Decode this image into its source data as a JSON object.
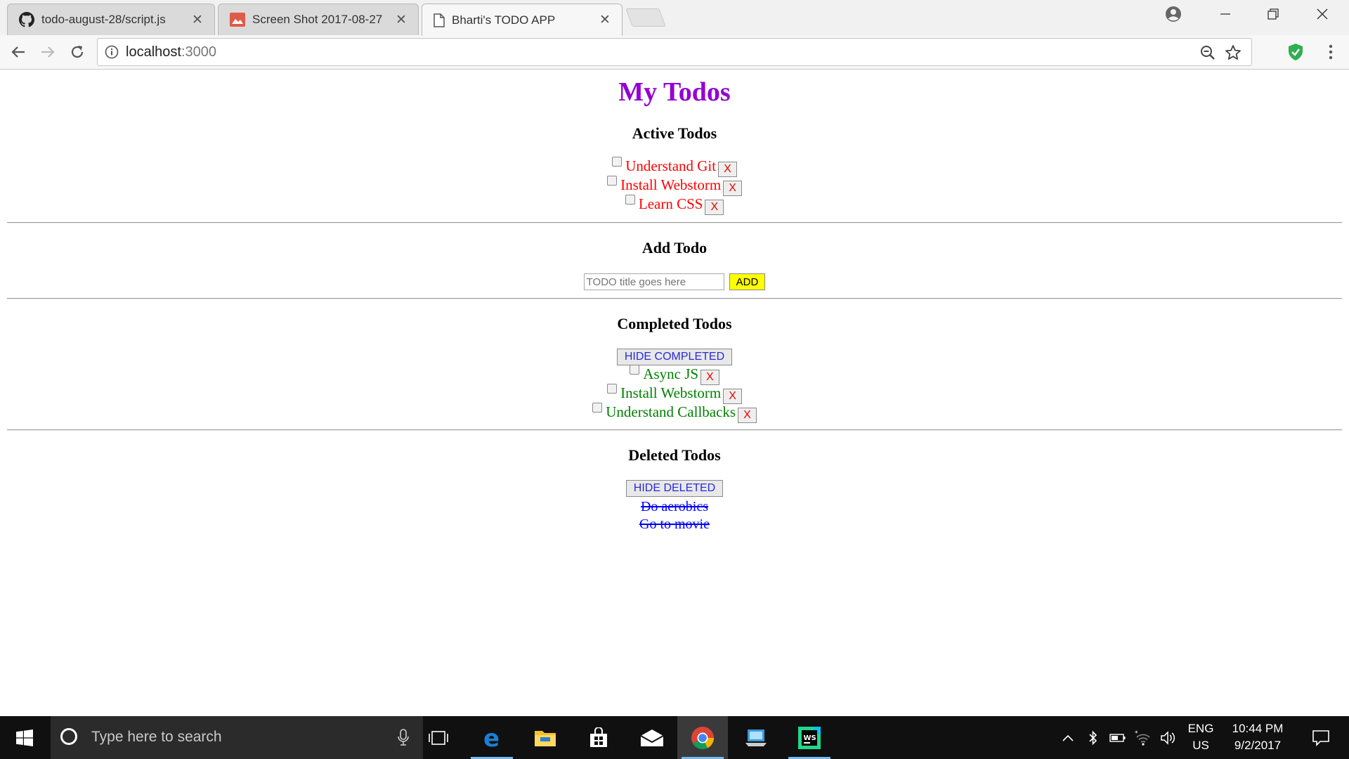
{
  "browser": {
    "tabs": [
      {
        "title": "todo-august-28/script.js",
        "icon": "github-icon",
        "active": false
      },
      {
        "title": "Screen Shot 2017-08-27",
        "icon": "image-icon",
        "active": false
      },
      {
        "title": "Bharti's TODO APP",
        "icon": "page-icon",
        "active": true
      }
    ],
    "url": {
      "host": "localhost",
      "port": ":3000"
    },
    "accent_shield": "#2eb050"
  },
  "page": {
    "title": "My Todos",
    "title_color": "#9400d3",
    "active_heading": "Active Todos",
    "active_todos": [
      "Understand Git",
      "Install Webstorm",
      "Learn CSS"
    ],
    "add_heading": "Add Todo",
    "input_placeholder": "TODO title goes here",
    "add_button": "ADD",
    "completed_heading": "Completed Todos",
    "hide_completed_button": "HIDE COMPLETED",
    "completed_todos": [
      "Async JS",
      "Install Webstorm",
      "Understand Callbacks"
    ],
    "deleted_heading": "Deleted Todos",
    "hide_deleted_button": "HIDE DELETED",
    "deleted_todos": [
      "Do aerobics",
      "Go to movie"
    ],
    "delete_label": "X"
  },
  "taskbar": {
    "search_placeholder": "Type here to search",
    "lang_top": "ENG",
    "lang_bottom": "US",
    "time": "10:44 PM",
    "date": "9/2/2017",
    "apps": [
      "task-view-icon",
      "edge-icon",
      "file-explorer-icon",
      "store-icon",
      "mail-icon",
      "chrome-icon",
      "desktop-app-icon",
      "webstorm-icon"
    ]
  }
}
